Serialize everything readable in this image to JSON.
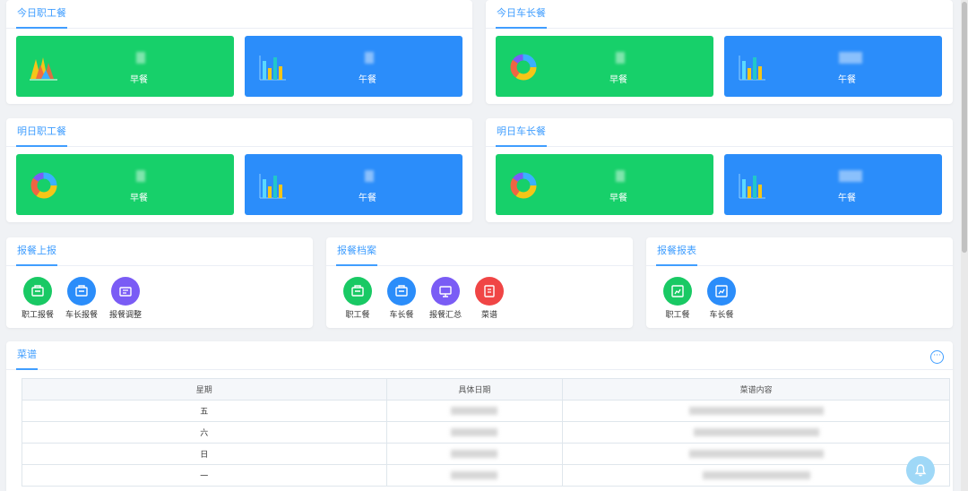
{
  "today_staff": {
    "title": "今日职工餐",
    "breakfast_label": "早餐",
    "lunch_label": "午餐"
  },
  "today_captain": {
    "title": "今日车长餐",
    "breakfast_label": "早餐",
    "lunch_label": "午餐"
  },
  "tomorrow_staff": {
    "title": "明日职工餐",
    "breakfast_label": "早餐",
    "lunch_label": "午餐"
  },
  "tomorrow_captain": {
    "title": "明日车长餐",
    "breakfast_label": "早餐",
    "lunch_label": "午餐"
  },
  "report_up": {
    "title": "报餐上报",
    "items": [
      {
        "label": "职工报餐",
        "color": "#19c964",
        "icon": "meal-report-icon"
      },
      {
        "label": "车长报餐",
        "color": "#2b8dfa",
        "icon": "meal-report-icon"
      },
      {
        "label": "报餐调整",
        "color": "#7a5cf5",
        "icon": "meal-adjust-icon"
      }
    ]
  },
  "report_archive": {
    "title": "报餐档案",
    "items": [
      {
        "label": "职工餐",
        "color": "#19c964",
        "icon": "archive-icon"
      },
      {
        "label": "车长餐",
        "color": "#2b8dfa",
        "icon": "archive-icon"
      },
      {
        "label": "报餐汇总",
        "color": "#7a5cf5",
        "icon": "summary-icon"
      },
      {
        "label": "菜谱",
        "color": "#f04545",
        "icon": "menu-book-icon"
      }
    ]
  },
  "report_table": {
    "title": "报餐报表",
    "items": [
      {
        "label": "职工餐",
        "color": "#19c964",
        "icon": "report-chart-icon"
      },
      {
        "label": "车长餐",
        "color": "#2b8dfa",
        "icon": "report-chart-icon"
      }
    ]
  },
  "menu_section": {
    "title": "菜谱",
    "more_icon": "more-icon",
    "columns": [
      "星期",
      "具体日期",
      "菜谱内容"
    ],
    "rows": [
      {
        "weekday": "五"
      },
      {
        "weekday": "六"
      },
      {
        "weekday": "日"
      },
      {
        "weekday": "一"
      }
    ]
  },
  "colors": {
    "accent": "#409eff",
    "tile_green": "#17d06a",
    "tile_blue": "#2b8dfa",
    "background": "#f0f2f5"
  }
}
